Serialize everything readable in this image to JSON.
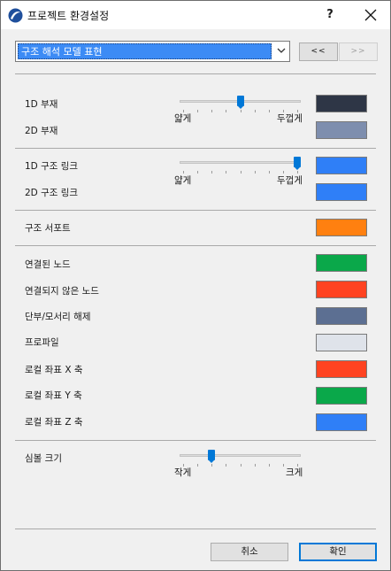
{
  "window": {
    "title": "프로젝트 환경설정",
    "help": "?",
    "icon": "app-logo-icon"
  },
  "top": {
    "dropdown_value": "구조 해석 모델 표현",
    "prev_label": "<<",
    "next_label": ">>",
    "next_disabled": true
  },
  "members": {
    "row1_label": "1D 부재",
    "row1_color": "#2e3646",
    "row2_label": "2D 부재",
    "row2_color": "#7e8eae",
    "slider_min": "얇게",
    "slider_max": "두껍게",
    "slider_level": 0.5
  },
  "links": {
    "row1_label": "1D 구조 링크",
    "row1_color": "#2f7ff7",
    "row2_label": "2D 구조 링크",
    "row2_color": "#2f7ff7",
    "slider_min": "얇게",
    "slider_max": "두껍게",
    "slider_level": 1.0
  },
  "support": {
    "label": "구조 서포트",
    "color": "#ff8010"
  },
  "nodes": {
    "items": [
      {
        "label": "연결된 노드",
        "color": "#0aa84a"
      },
      {
        "label": "연결되지 않은 노드",
        "color": "#ff4321"
      },
      {
        "label": "단부/모서리 해제",
        "color": "#5c6f92"
      },
      {
        "label": "프로파일",
        "color": "#dfe3ea"
      },
      {
        "label": "로컬 좌표 X 축",
        "color": "#ff4321"
      },
      {
        "label": "로컬 좌표 Y 축",
        "color": "#0aa84a"
      },
      {
        "label": "로컬 좌표 Z 축",
        "color": "#2f7ff7"
      }
    ]
  },
  "symbol": {
    "label": "심볼 크기",
    "slider_min": "작게",
    "slider_max": "크게",
    "slider_level": 0.25
  },
  "buttons": {
    "cancel": "취소",
    "ok": "확인"
  }
}
